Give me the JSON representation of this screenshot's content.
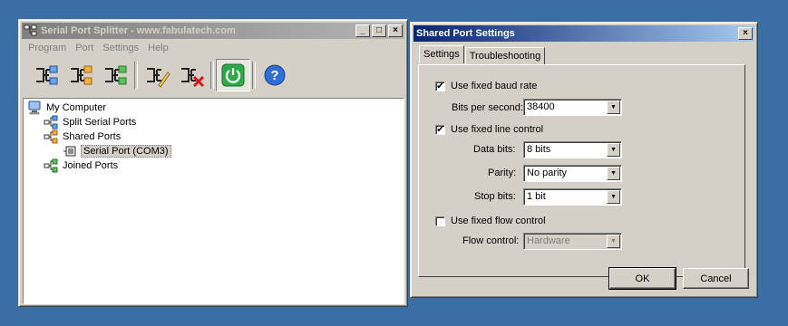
{
  "main_window": {
    "title": "Serial Port Splitter - www.fabulatech.com",
    "title_buttons": {
      "minimize": "_",
      "maximize": "□",
      "close": "×"
    },
    "menu": [
      "Program",
      "Port",
      "Settings",
      "Help"
    ],
    "toolbar": [
      {
        "icon": "split-port-icon"
      },
      {
        "icon": "shared-port-icon"
      },
      {
        "icon": "joined-port-icon"
      },
      {
        "icon": "edit-port-icon"
      },
      {
        "icon": "delete-port-icon"
      },
      {
        "icon": "power-icon",
        "pressed": true
      },
      {
        "icon": "help-icon"
      }
    ],
    "tree": {
      "root": "My Computer",
      "split": "Split Serial Ports",
      "shared": "Shared Ports",
      "shared_child": "Serial Port (COM3)",
      "joined": "Joined Ports"
    }
  },
  "dialog": {
    "title": "Shared Port Settings",
    "close": "×",
    "tabs": [
      "Settings",
      "Troubleshooting"
    ],
    "active_tab": "Settings",
    "baud": {
      "label": "Use fixed baud rate",
      "checked": true,
      "field_label": "Bits per second:",
      "value": "38400"
    },
    "line": {
      "label": "Use fixed line control",
      "checked": true,
      "data_bits_label": "Data bits:",
      "data_bits": "8 bits",
      "parity_label": "Parity:",
      "parity": "No parity",
      "stop_bits_label": "Stop bits:",
      "stop_bits": "1 bit"
    },
    "flow": {
      "label": "Use fixed flow control",
      "checked": false,
      "field_label": "Flow control:",
      "value": "Hardware"
    },
    "ok": "OK",
    "cancel": "Cancel"
  },
  "colors": {
    "desktop": "#3a6ea5",
    "face": "#d4d0c8",
    "active_title": "#0a246a",
    "inactive_title": "#808080"
  }
}
